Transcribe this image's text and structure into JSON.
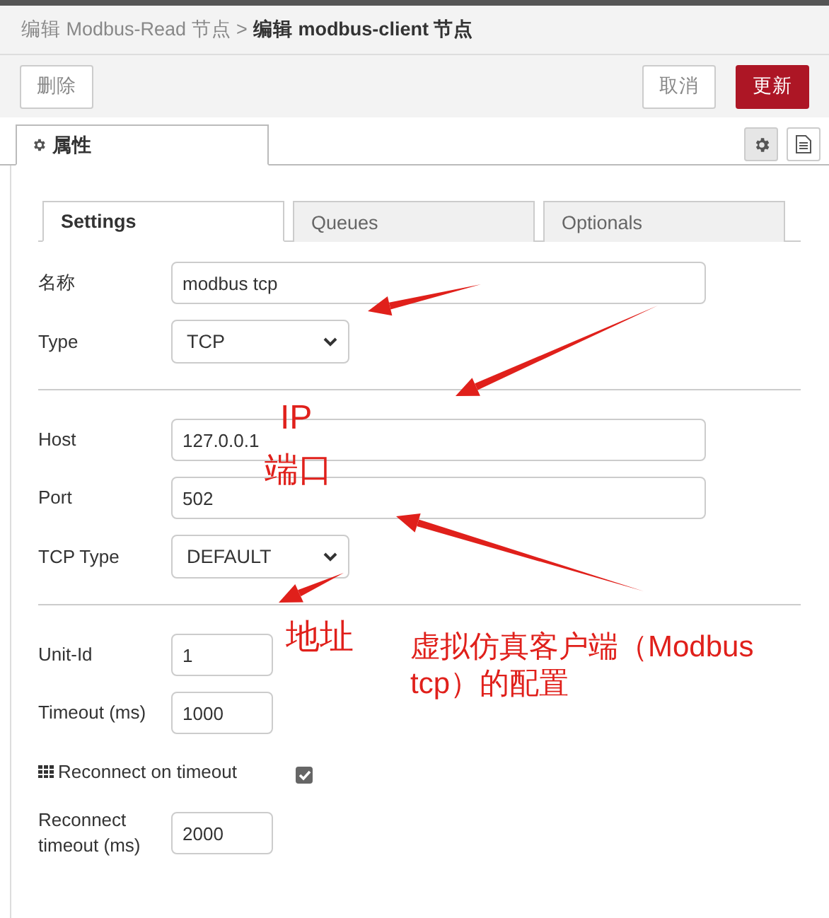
{
  "breadcrumb": {
    "parent": "编辑 Modbus-Read 节点 >",
    "current": "编辑 modbus-client 节点"
  },
  "buttons": {
    "delete": "删除",
    "cancel": "取消",
    "update": "更新"
  },
  "panel_tabs": [
    {
      "label": "属性",
      "selected": true
    }
  ],
  "tabs": [
    {
      "label": "Settings",
      "selected": true
    },
    {
      "label": "Queues",
      "selected": false
    },
    {
      "label": "Optionals",
      "selected": false
    }
  ],
  "groups": [
    [
      {
        "kind": "text",
        "label": "名称",
        "value": "modbus tcp",
        "wide": true
      },
      {
        "kind": "select",
        "label": "Type",
        "value": "TCP"
      }
    ],
    [
      {
        "kind": "text",
        "label": "Host",
        "value": "127.0.0.1",
        "wide": true
      },
      {
        "kind": "text",
        "label": "Port",
        "value": "502",
        "wide": true
      },
      {
        "kind": "select",
        "label": "TCP Type",
        "value": "DEFAULT"
      }
    ],
    [
      {
        "kind": "text",
        "label": "Unit-Id",
        "value": "1",
        "wide": false
      },
      {
        "kind": "text",
        "label": "Timeout (ms)",
        "value": "1000",
        "wide": false
      },
      {
        "kind": "checkbox",
        "label": "Reconnect on timeout",
        "checked": true
      },
      {
        "kind": "text",
        "label": "Reconnect timeout (ms)",
        "value": "2000",
        "wide": false
      }
    ]
  ],
  "annotations": [
    {
      "text": "IP"
    },
    {
      "text": "端口"
    },
    {
      "text": "地址"
    },
    {
      "text": "虚拟仿真客户端（Modbus tcp）的配置"
    }
  ]
}
